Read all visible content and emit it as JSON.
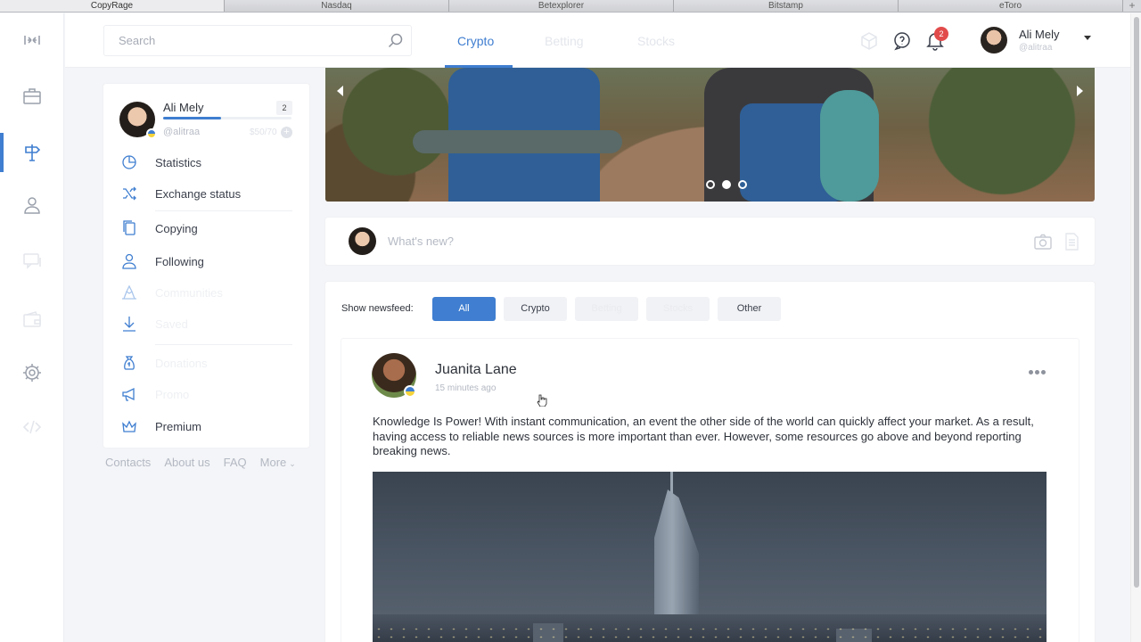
{
  "browser_tabs": [
    "CopyRage",
    "Nasdaq",
    "Betexplorer",
    "Bitstamp",
    "eToro"
  ],
  "browser_tab_add": "+",
  "rail": {
    "items": [
      {
        "icon": "collapse-icon"
      },
      {
        "icon": "briefcase-icon"
      },
      {
        "icon": "signpost-icon",
        "active": true
      },
      {
        "icon": "user-icon"
      },
      {
        "icon": "chat-icon"
      },
      {
        "icon": "wallet-icon"
      },
      {
        "icon": "settings-icon"
      },
      {
        "icon": "code-icon"
      }
    ]
  },
  "header": {
    "search_placeholder": "Search",
    "tabs": [
      {
        "label": "Crypto",
        "active": true
      },
      {
        "label": "Betting",
        "active": false
      },
      {
        "label": "Stocks",
        "active": false
      }
    ],
    "notification_count": "2",
    "user": {
      "name": "Ali Mely",
      "handle": "@alitraa"
    }
  },
  "profile": {
    "name": "Ali Mely",
    "handle": "@alitraa",
    "count": "2",
    "points": "$50/70",
    "progress": 0.45,
    "menu": [
      {
        "label": "Statistics",
        "icon": "pie-chart-icon"
      },
      {
        "label": "Exchange status",
        "icon": "shuffle-icon"
      },
      {
        "label": "Copying",
        "icon": "copy-icon"
      },
      {
        "label": "Following",
        "icon": "person-icon"
      },
      {
        "label": "Communities",
        "icon": "community-icon"
      },
      {
        "label": "Saved",
        "icon": "download-icon"
      },
      {
        "label": "Donations",
        "icon": "money-bag-icon"
      },
      {
        "label": "Promo",
        "icon": "megaphone-icon"
      },
      {
        "label": "Premium",
        "icon": "crown-icon"
      }
    ]
  },
  "footer_links": [
    "Contacts",
    "About us",
    "FAQ",
    "More"
  ],
  "banner": {
    "slides": 3,
    "active_slide": 2
  },
  "composer": {
    "placeholder": "What's new?"
  },
  "feed": {
    "label": "Show newsfeed:",
    "filters": [
      {
        "label": "All",
        "active": true
      },
      {
        "label": "Crypto",
        "active": false
      },
      {
        "label": "Betting",
        "active": false
      },
      {
        "label": "Stocks",
        "active": false
      },
      {
        "label": "Other",
        "active": false
      }
    ]
  },
  "post": {
    "author": "Juanita Lane",
    "time": "15 minutes ago",
    "text": "Knowledge Is Power! With instant communication, an event the other side of the world can quickly affect your market. As a result, having access to reliable news sources is more important than ever. However, some resources go above and beyond reporting breaking news."
  },
  "colors": {
    "accent": "#3f7ed0",
    "badge": "#e24b4b"
  }
}
